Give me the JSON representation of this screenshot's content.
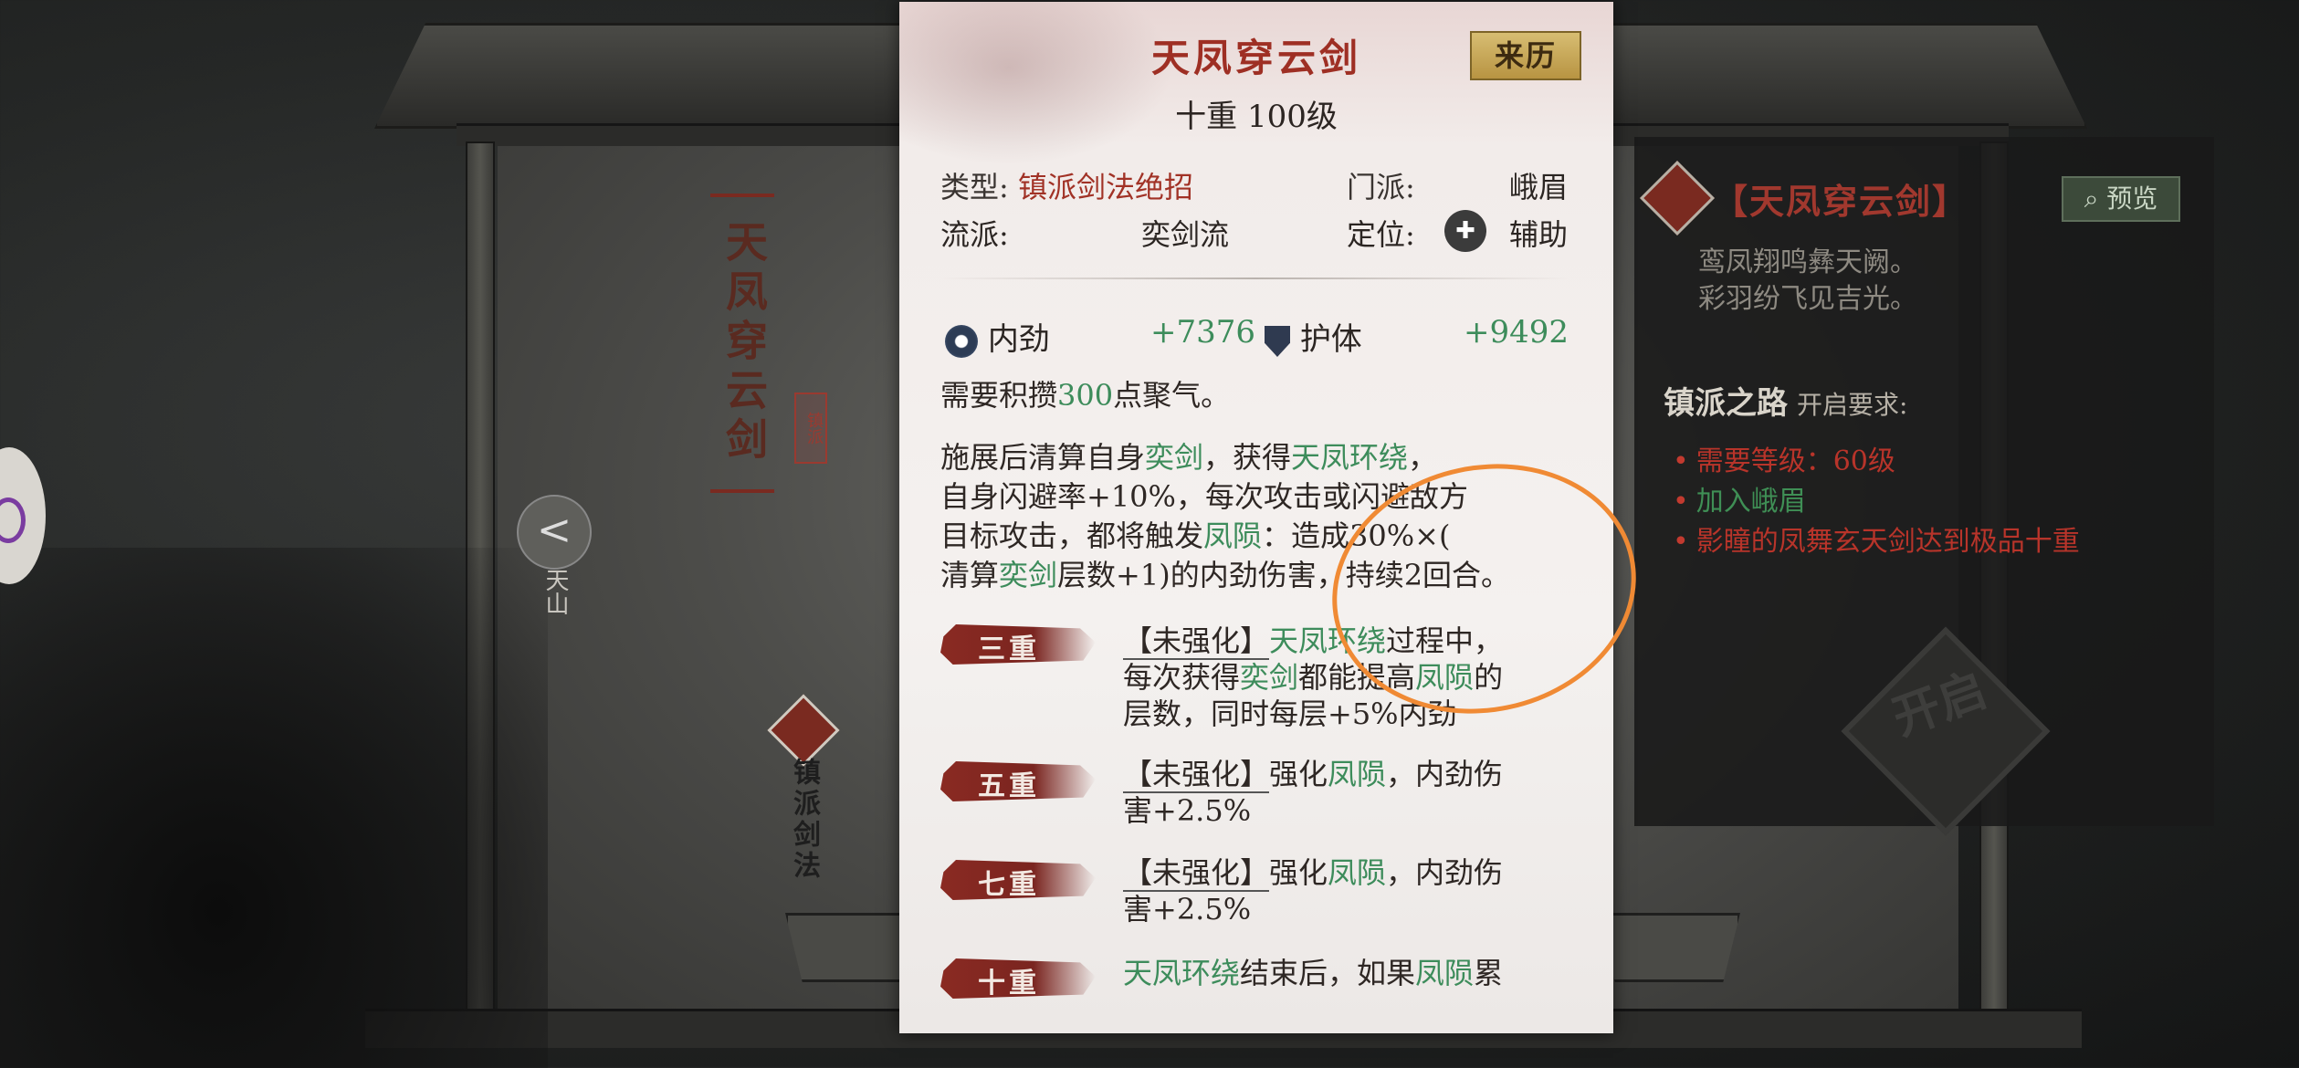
{
  "background": {
    "vertical_title": "天凤穿云剑",
    "seal_text": "镇派",
    "sect_badge_label": "天山",
    "sect_category": "镇派剑法"
  },
  "card": {
    "title": "天凤穿云剑",
    "origin_button": "来历",
    "level": "十重 100级",
    "type_label": "类型:",
    "type_value": "镇派剑法绝招",
    "sect_label": "门派:",
    "sect_value": "峨眉",
    "school_label": "流派:",
    "school_value": "奕剑流",
    "role_label": "定位:",
    "role_value": "辅助",
    "stats": [
      {
        "icon": "internal-force-icon",
        "label": "内劲",
        "value": "+7376"
      },
      {
        "icon": "shield-icon",
        "label": "护体",
        "value": "+9492"
      }
    ],
    "require_pre": "需要积攒",
    "require_num": "300",
    "require_post": "点聚气。",
    "desc_parts": {
      "p1": "施展后清算自身",
      "k1": "奕剑",
      "p2": "，获得",
      "k2": "天凤环绕",
      "p3": "，",
      "line2": "自身闪避率+10%，每次攻击或闪避敌方",
      "line3a": "目标攻击，都将触发",
      "k3": "凤陨",
      "line3b": "：造成30%×(",
      "line4a": "清算",
      "k4": "奕剑",
      "line4b": "层数+1)的内劲伤害，持续2回合。"
    },
    "tiers": [
      {
        "name": "三重",
        "status": "【未强化】",
        "k1": "天凤环绕",
        "t1": "过程中，",
        "t2": "每次获得",
        "k2": "奕剑",
        "t3": "都能提高",
        "k3": "凤陨",
        "t4": "的",
        "t5": "层数，同时每层+5%内劲"
      },
      {
        "name": "五重",
        "status": "【未强化】",
        "t1": "强化",
        "k1": "凤陨",
        "t2": "，内劲伤",
        "t3": "害+2.5%"
      },
      {
        "name": "七重",
        "status": "【未强化】",
        "t1": "强化",
        "k1": "凤陨",
        "t2": "，内劲伤",
        "t3": "害+2.5%"
      },
      {
        "name": "十重",
        "k1": "天凤环绕",
        "t1": "结束后，如果",
        "k2": "凤陨",
        "t2": "累"
      }
    ]
  },
  "right_panel": {
    "title": "【天凤穿云剑】",
    "preview_button": "预览",
    "poem_line1": "鸾凤翔鸣彝天阙。",
    "poem_line2": "彩羽纷飞见吉光。",
    "path_title": "镇派之路",
    "path_sub": "开启要求:",
    "requirements": [
      {
        "text": "需要等级：60级",
        "color": "#b8342a"
      },
      {
        "text": "加入峨眉",
        "color": "#3f8f55"
      },
      {
        "text": "影瞳的凤舞玄天剑达到极品十重",
        "color": "#b8342a"
      }
    ],
    "open_seal": "开启"
  },
  "colors": {
    "accent_red": "#9e2f24",
    "keyword_green": "#3d8c5b",
    "annotation_orange": "#f08a34"
  }
}
